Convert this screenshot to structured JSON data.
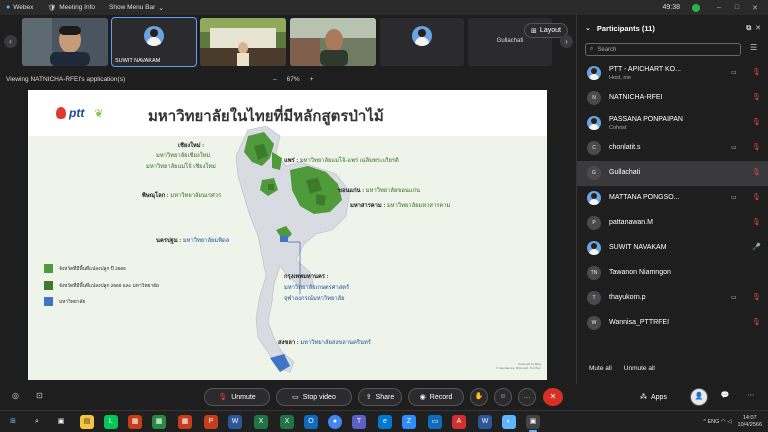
{
  "titlebar": {
    "app": "Webex",
    "meeting_info": "Meeting Info",
    "show_menu": "Show Menu Bar",
    "clock": "49:38"
  },
  "video_strip": {
    "tiles": [
      {
        "name": ""
      },
      {
        "name": "SUWIT NAVAKAM"
      },
      {
        "name": ""
      },
      {
        "name": ""
      },
      {
        "name": ""
      },
      {
        "name": "Gullachati"
      }
    ],
    "layout_label": "Layout"
  },
  "viewbar": {
    "label": "Viewing NATNICHA-RFEI's application(s)",
    "zoom": "67%",
    "minus": "–",
    "plus": "+"
  },
  "slide": {
    "logo_text": "ptt",
    "title": "มหาวิทยาลัยในไทยที่มีหลักสูตรป่าไม้",
    "labels": {
      "chiangmai_head": "เชียงใหม่ :",
      "chiangmai_1": "มหาวิทยาลัยเชียงใหม่",
      "chiangmai_2": "มหาวิทยาลัยแม่โจ้ เชียงใหม่",
      "phrae_head": "แพร่ :",
      "phrae_1": "มหาวิทยาลัยแม่โจ้-แพร่ เฉลิมพระเกียรติ",
      "phitsanulok_head": "พิษณุโลก :",
      "phitsanulok_1": "มหาวิทยาลัยนเรศวร",
      "khonkaen_head": "ขอนแก่น :",
      "khonkaen_1": "มหาวิทยาลัยขอนแก่น",
      "maha_head": "มหาสารคาม :",
      "maha_1": "มหาวิทยาลัยมหาสารคาม",
      "nakhon_head": "นครปฐม :",
      "nakhon_1": "มหาวิทยาลัยมหิดล",
      "bkk_head": "กรุงเทพมหานคร :",
      "bkk_1": "มหาวิทยาลัยเกษตรศาสตร์",
      "bkk_2": "จุฬาลงกรณ์มหาวิทยาลัย",
      "songkhla_head": "สงขลา :",
      "songkhla_1": "มหาวิทยาลัยสงขลานครินทร์"
    },
    "legend": [
      {
        "text": "จังหวัดที่มีพื้นที่แปลงปลูก ปี 2566",
        "color": "#4f9a3a"
      },
      {
        "text": "จังหวัดที่มีพื้นที่แปลงปลูก 2566 และ มหาวิทยาลัย",
        "color": "#3e7a2c"
      },
      {
        "text": "มหาวิทยาลัย",
        "color": "#3f74c6"
      }
    ],
    "credit_1": "Powered by Bing",
    "credit_2": "© GeoNames, Microsoft, TomTom"
  },
  "participants": {
    "title": "Participants",
    "count": "(11)",
    "search_placeholder": "Search",
    "rows": [
      {
        "name": "PTT - APICHART KO...",
        "sub": "Host, me",
        "avatar": "",
        "cam": true,
        "mic": "muted"
      },
      {
        "name": "NATNICHA-RFEI",
        "sub": "",
        "avatar": "N",
        "cam": false,
        "mic": "muted"
      },
      {
        "name": "PASSANA PONPAIPAN",
        "sub": "Cohost",
        "avatar": "",
        "cam": false,
        "mic": "muted"
      },
      {
        "name": "chonlatit.s",
        "sub": "",
        "avatar": "C",
        "cam": true,
        "mic": "muted"
      },
      {
        "name": "Gullachati",
        "sub": "",
        "avatar": "G",
        "cam": false,
        "mic": "muted"
      },
      {
        "name": "MATTANA PONGSO...",
        "sub": "",
        "avatar": "",
        "cam": true,
        "mic": "muted"
      },
      {
        "name": "pattanawan.M",
        "sub": "",
        "avatar": "P",
        "cam": false,
        "mic": "muted"
      },
      {
        "name": "SUWIT NAVAKAM",
        "sub": "",
        "avatar": "",
        "cam": false,
        "mic": "on"
      },
      {
        "name": "Tawanon Niamngon",
        "sub": "",
        "avatar": "TN",
        "cam": false,
        "mic": "none"
      },
      {
        "name": "thayukorn.p",
        "sub": "",
        "avatar": "T",
        "cam": true,
        "mic": "muted"
      },
      {
        "name": "Wannisa_PTTRFEI",
        "sub": "",
        "avatar": "W",
        "cam": false,
        "mic": "muted"
      }
    ],
    "mute_all": "Mute all",
    "unmute_all": "Unmute all"
  },
  "controls": {
    "unmute": "Unmute",
    "stop_video": "Stop video",
    "share": "Share",
    "record": "Record",
    "apps": "Apps"
  },
  "taskbar": {
    "time": "14:07",
    "date": "10/4/2566",
    "lang": "ENG"
  }
}
